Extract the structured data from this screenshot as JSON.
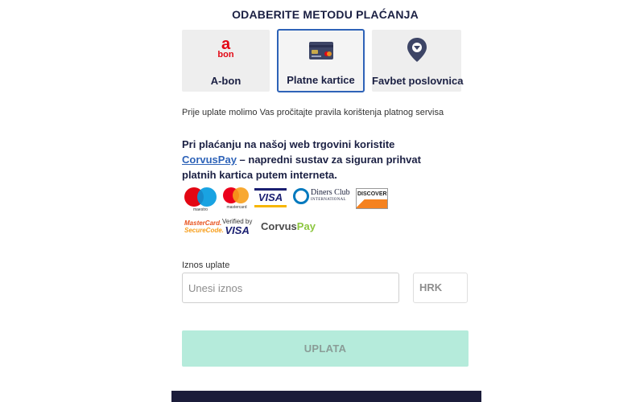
{
  "header": {
    "title": "ODABERITE METODU PLAĆANJA"
  },
  "payment_methods": [
    {
      "label": "A-bon",
      "icon": "a-bon-logo",
      "icon_text_top": "a",
      "icon_text_bottom": "bon",
      "selected": false
    },
    {
      "label": "Platne kartice",
      "icon": "bank-card-icon",
      "selected": true
    },
    {
      "label": "Favbet poslovnica",
      "icon": "location-pin-icon",
      "selected": false
    }
  ],
  "notice": "Prije uplate molimo Vas pročitajte pravila korištenja platnog servisa",
  "intro": {
    "before_link": "Pri plaćanju na našoj web trgovini koristite ",
    "link_text": "CorvusPay",
    "after_link": " – napredni sustav za siguran prihvat platnih kartica putem interneta."
  },
  "card_logos": {
    "maestro": "maestro",
    "mastercard": "mastercard",
    "visa": "VISA",
    "diners_line1": "Diners Club",
    "diners_line2": "INTERNATIONAL",
    "discover": "DISCOVER",
    "securecode_line1": "MasterCard.",
    "securecode_line2": "SecureCode.",
    "vbv_line1": "Verified by",
    "vbv_line2": "VISA",
    "corvus_a": "Corvus",
    "corvus_b": "Pay"
  },
  "amount": {
    "label": "Iznos uplate",
    "placeholder": "Unesi iznos",
    "value": "",
    "currency": "HRK"
  },
  "submit": {
    "label": "UPLATA"
  },
  "colors": {
    "accent": "#2e63b8",
    "submit_bg": "#b5ebdb",
    "brand_red": "#e30613",
    "dark_navy": "#1b1c3a"
  }
}
